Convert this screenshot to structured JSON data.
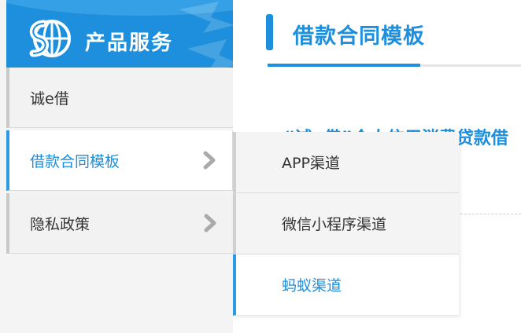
{
  "sidebar": {
    "title": "产品服务",
    "items": [
      {
        "label": "诚e借",
        "has_submenu": false
      },
      {
        "label": "借款合同模板",
        "has_submenu": true,
        "active": true
      },
      {
        "label": "隐私政策",
        "has_submenu": true
      }
    ]
  },
  "main": {
    "title": "借款合同模板",
    "document_link": "“诚e借”个人信用消费贷款借"
  },
  "submenu": {
    "items": [
      {
        "label": "APP渠道"
      },
      {
        "label": "微信小程序渠道"
      },
      {
        "label": "蚂蚁渠道",
        "active": true
      }
    ]
  },
  "colors": {
    "brand_blue": "#1e8fdc",
    "active_border": "#2b9be6",
    "menu_background": "#f2f2f2",
    "text_default": "#333333"
  },
  "icons": {
    "logo": "bank-logo-icon",
    "chevron": "chevron-right-icon"
  }
}
